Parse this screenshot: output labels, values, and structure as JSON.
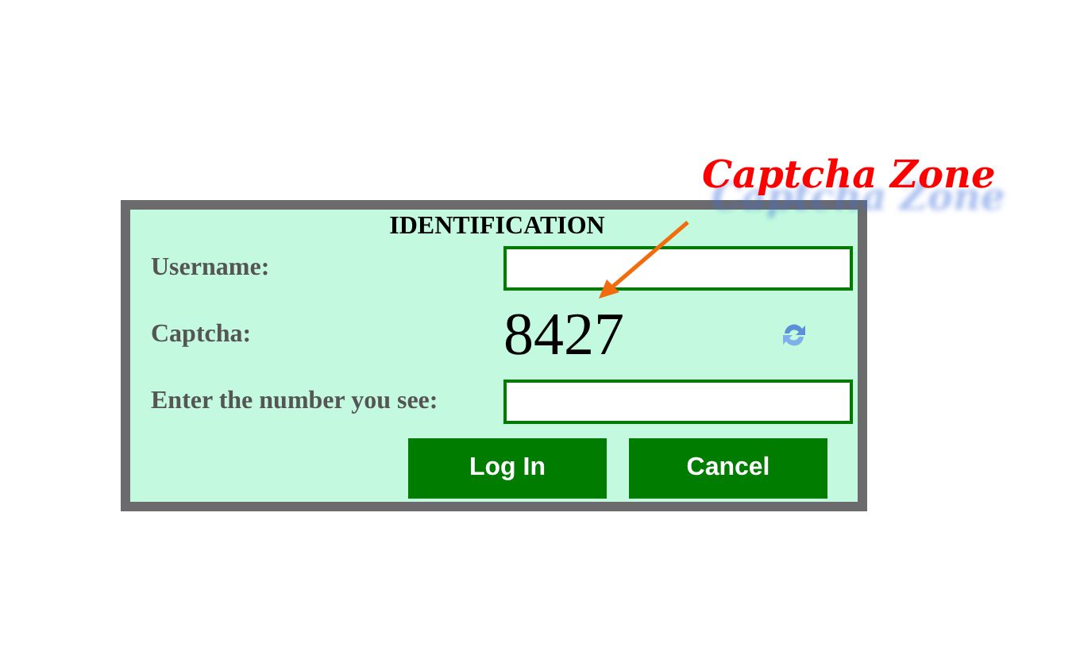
{
  "annotation": {
    "label": "Captcha Zone"
  },
  "form": {
    "title": "IDENTIFICATION",
    "rows": [
      {
        "kind": "input",
        "label": "Username:"
      },
      {
        "kind": "captcha",
        "label": "Captcha:",
        "value": "8427"
      },
      {
        "kind": "input",
        "label": "Enter the number you see:"
      }
    ],
    "buttons": [
      "Log In",
      "Cancel"
    ]
  }
}
